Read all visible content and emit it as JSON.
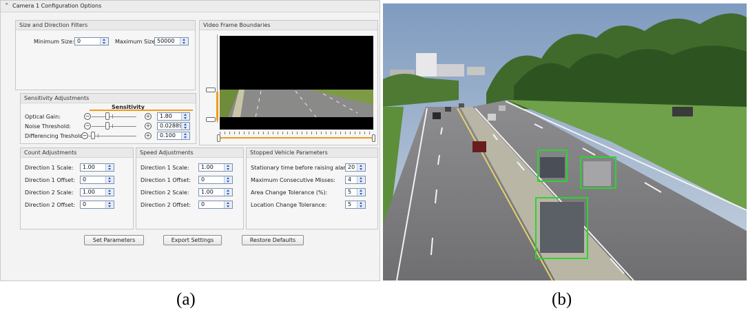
{
  "window": {
    "title": "Camera 1 Configuration Options"
  },
  "filters": {
    "title": "Size and Direction Filters",
    "min_label": "Minimum Size:",
    "min_value": "0",
    "max_label": "Maximum Size:",
    "max_value": "50000"
  },
  "video": {
    "title": "Video Frame Boundaries"
  },
  "sensitivity": {
    "title": "Sensitivity Adjustments",
    "header": "Sensitivity",
    "rows": [
      {
        "label": "Optical Gain:",
        "value": "1.80",
        "position": 0.3
      },
      {
        "label": "Noise Threshold:",
        "value": "0.02889",
        "position": 0.3
      },
      {
        "label": "Differencing Treshold:",
        "value": "0.100",
        "position": 0.05
      }
    ]
  },
  "count": {
    "title": "Count Adjustments",
    "rows": [
      {
        "label": "Direction 1 Scale:",
        "value": "1.00"
      },
      {
        "label": "Direction 1 Offset:",
        "value": "0"
      },
      {
        "label": "Direction 2 Scale:",
        "value": "1.00"
      },
      {
        "label": "Direction 2 Offset:",
        "value": "0"
      }
    ]
  },
  "speed": {
    "title": "Speed Adjustments",
    "rows": [
      {
        "label": "Direction 1 Scale:",
        "value": "1.00"
      },
      {
        "label": "Direction 1 Offset:",
        "value": "0"
      },
      {
        "label": "Direction 2 Scale:",
        "value": "1.00"
      },
      {
        "label": "Direction 2 Offset:",
        "value": "0"
      }
    ]
  },
  "stopped": {
    "title": "Stopped Vehicle Parameters",
    "rows": [
      {
        "label": "Stationary time before raising alarm:",
        "value": "20"
      },
      {
        "label": "Maximum Consecutive Misses:",
        "value": "4"
      },
      {
        "label": "Area Change Tolerance (%):",
        "value": "5"
      },
      {
        "label": "Location Change Tolerance:",
        "value": "5"
      }
    ]
  },
  "buttons": {
    "set": "Set Parameters",
    "export": "Export Settings",
    "restore": "Restore Defaults"
  },
  "captions": {
    "a": "(a)",
    "b": "(b)"
  },
  "colors": {
    "accent_orange": "#f29a1a",
    "detection_box": "#2bd62b",
    "spin_border": "#7a8fb0"
  },
  "icons": {
    "collapse": "double-chevron-up-icon",
    "spinner": "spinner-arrows-icon",
    "zoom_out": "minus-circle-icon",
    "zoom_in": "plus-circle-icon"
  }
}
